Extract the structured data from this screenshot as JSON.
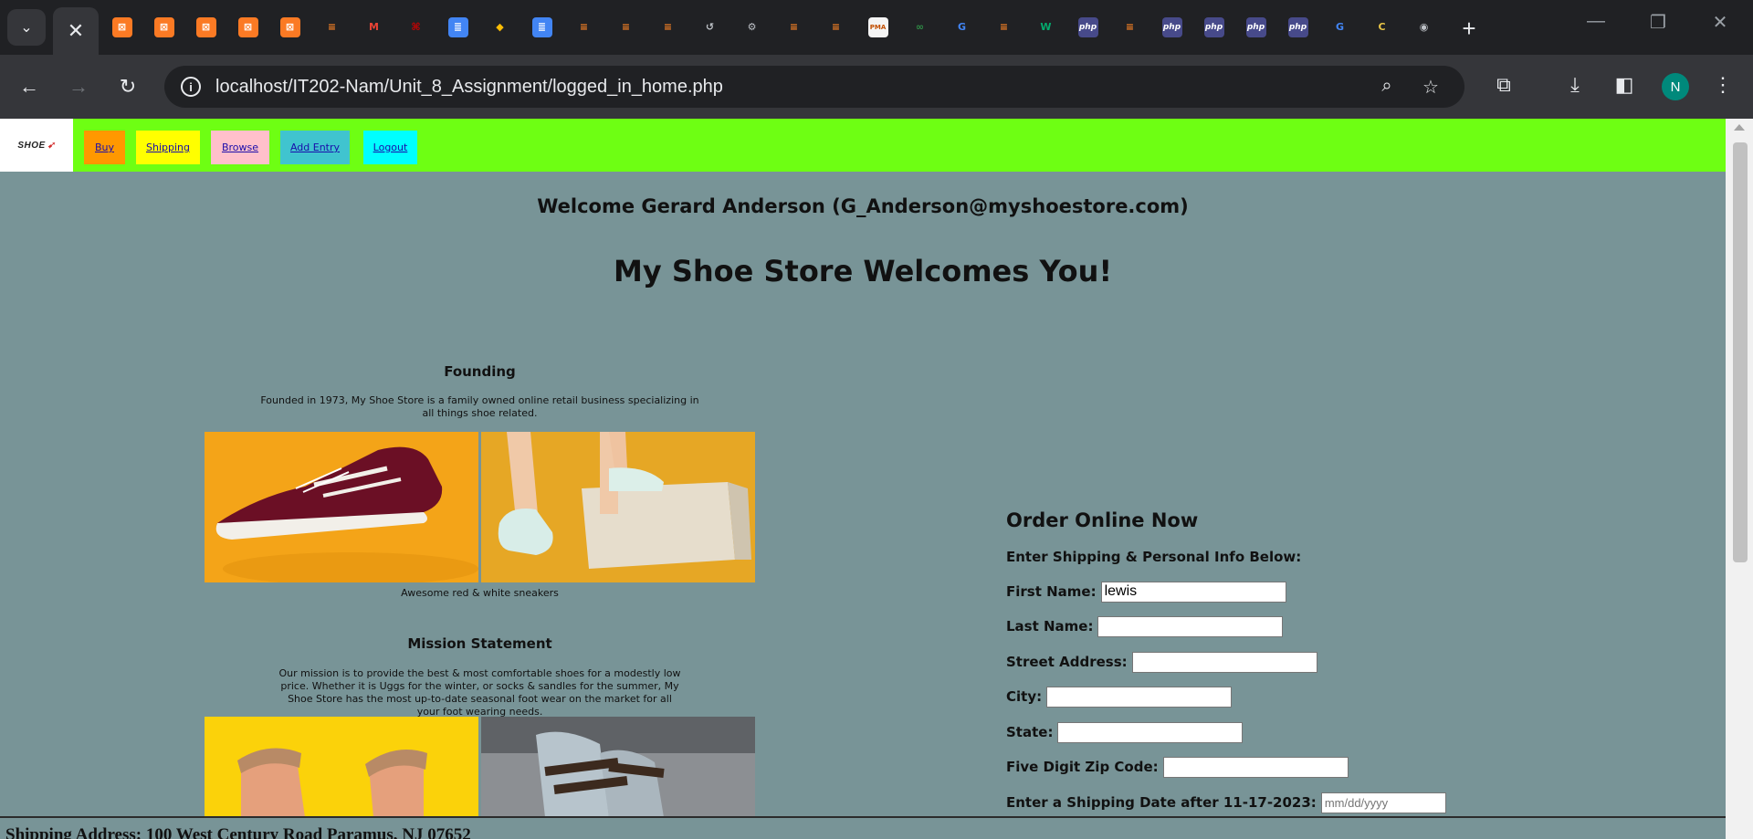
{
  "browser": {
    "address": {
      "host": "localhost",
      "path": "/IT202-Nam/Unit_8_Assignment/logged_in_home.php"
    },
    "profile_initial": "N",
    "tab_icons": [
      {
        "name": "xampp-tab-icon",
        "glyph": "⊠",
        "color": "#fb7a24"
      },
      {
        "name": "xampp-tab-icon",
        "glyph": "⊠",
        "color": "#fb7a24"
      },
      {
        "name": "xampp-tab-icon",
        "glyph": "⊠",
        "color": "#fb7a24"
      },
      {
        "name": "xampp-tab-icon",
        "glyph": "⊠",
        "color": "#fb7a24"
      },
      {
        "name": "xampp-tab-icon",
        "glyph": "⊠",
        "color": "#fb7a24"
      },
      {
        "name": "stackoverflow-tab-icon",
        "glyph": "≡",
        "color": "#f48024"
      },
      {
        "name": "gmail-tab-icon",
        "glyph": "M",
        "color": "#ea4335"
      },
      {
        "name": "njit-tab-icon",
        "glyph": "⌘",
        "color": "#cc0000"
      },
      {
        "name": "google-docs-tab-icon",
        "glyph": "≣",
        "color": "#4285f4"
      },
      {
        "name": "shield-tab-icon",
        "glyph": "◆",
        "color": "#fbbc05"
      },
      {
        "name": "google-docs-tab-icon",
        "glyph": "≣",
        "color": "#4285f4"
      },
      {
        "name": "stackoverflow-tab-icon",
        "glyph": "≡",
        "color": "#f48024"
      },
      {
        "name": "stackoverflow-tab-icon",
        "glyph": "≡",
        "color": "#f48024"
      },
      {
        "name": "stackoverflow-tab-icon",
        "glyph": "≡",
        "color": "#f48024"
      },
      {
        "name": "history-tab-icon",
        "glyph": "↺",
        "color": "#bdc1c6"
      },
      {
        "name": "settings-tab-icon",
        "glyph": "⚙",
        "color": "#bdc1c6"
      },
      {
        "name": "stackoverflow-tab-icon",
        "glyph": "≡",
        "color": "#f48024"
      },
      {
        "name": "stackoverflow-tab-icon",
        "glyph": "≡",
        "color": "#f48024"
      },
      {
        "name": "phpmyadmin-tab-icon",
        "glyph": "PMA",
        "color": "#f4f4f4"
      },
      {
        "name": "geeksforgeeks-tab-icon",
        "glyph": "∞",
        "color": "#2f8d46"
      },
      {
        "name": "google-tab-icon",
        "glyph": "G",
        "color": "#4285f4"
      },
      {
        "name": "stackoverflow-tab-icon",
        "glyph": "≡",
        "color": "#f48024"
      },
      {
        "name": "w3schools-tab-icon",
        "glyph": "W",
        "color": "#04aa6d"
      },
      {
        "name": "php-tab-icon",
        "glyph": "php",
        "color": "#777bb3"
      },
      {
        "name": "stackoverflow-tab-icon",
        "glyph": "≡",
        "color": "#f48024"
      },
      {
        "name": "php-tab-icon",
        "glyph": "php",
        "color": "#777bb3"
      },
      {
        "name": "php-tab-icon",
        "glyph": "php",
        "color": "#777bb3"
      },
      {
        "name": "php-tab-icon",
        "glyph": "php",
        "color": "#777bb3"
      },
      {
        "name": "php-tab-icon",
        "glyph": "php",
        "color": "#777bb3"
      },
      {
        "name": "google-tab-icon",
        "glyph": "G",
        "color": "#4285f4"
      },
      {
        "name": "chatgpt-tab-icon",
        "glyph": "C",
        "color": "#e8c547"
      },
      {
        "name": "chrome-tab-icon",
        "glyph": "◉",
        "color": "#bdc1c6"
      }
    ]
  },
  "site": {
    "logo_text": "SHOE",
    "nav": [
      {
        "label": "Buy",
        "color": "#ff9800"
      },
      {
        "label": "Shipping",
        "color": "#ffff00"
      },
      {
        "label": "Browse",
        "color": "#ffc0cb"
      },
      {
        "label": "Add Entry",
        "color": "#40c4cf"
      },
      {
        "label": "Logout",
        "color": "#00ffff"
      }
    ],
    "welcome": "Welcome Gerard Anderson (G_Anderson@myshoestore.com)",
    "headline": "My Shoe Store Welcomes You!",
    "founding": {
      "title": "Founding",
      "text": "Founded in 1973, My Shoe Store is a family owned online retail business specializing in all things shoe related.",
      "caption": "Awesome red & white sneakers"
    },
    "mission": {
      "title": "Mission Statement",
      "text": "Our mission is to provide the best & most comfortable shoes for a modestly low price. Whether it is Uggs for the winter, or socks & sandles for the summer, My Shoe Store has the most up-to-date seasonal foot wear on the market for all your foot wearing needs."
    },
    "order": {
      "title": "Order Online Now",
      "subtitle": "Enter Shipping & Personal Info Below:",
      "fields": [
        {
          "label": "First Name:",
          "value": "lewis"
        },
        {
          "label": "Last Name:",
          "value": ""
        },
        {
          "label": "Street Address:",
          "value": ""
        },
        {
          "label": "City:",
          "value": ""
        },
        {
          "label": "State:",
          "value": ""
        },
        {
          "label": "Five Digit Zip Code:",
          "value": ""
        }
      ],
      "date_label": "Enter a Shipping Date after 11-17-2023:",
      "date_placeholder": "mm/dd/yyyy"
    },
    "footer": "Shipping Address: 100 West Century Road Paramus, NJ 07652",
    "colors": {
      "background": "#789497",
      "nav_bar": "#6eff13"
    }
  }
}
